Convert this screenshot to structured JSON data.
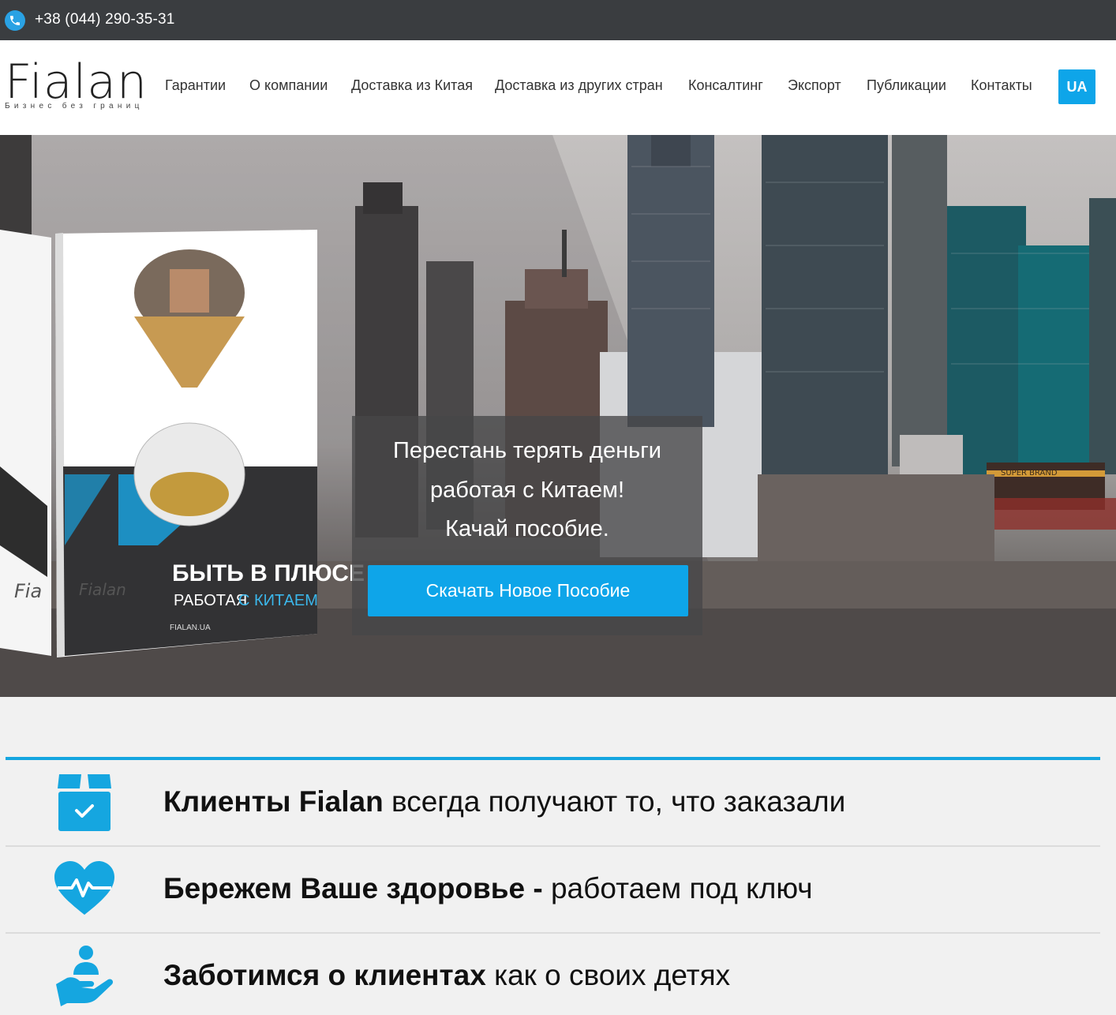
{
  "topbar": {
    "phone": "+38 (044) 290-35-31",
    "phone_icon": "phone-icon"
  },
  "header": {
    "logo_text": "Fialan",
    "logo_tagline": "Бизнес без границ",
    "nav": [
      "Гарантии",
      "О компании",
      "Доставка из Китая",
      "Доставка из других стран",
      "Консалтинг",
      "Экспорт",
      "Публикации",
      "Контакты"
    ],
    "lang": "UA"
  },
  "hero": {
    "book": {
      "title_line1": "БЫТЬ В ПЛЮСЕ",
      "title_line2a": "РАБОТАЯ",
      "title_line2b": "С КИТАЕМ",
      "brand": "Fialan",
      "brand_left": "Fia",
      "site": "FIALAN.UA",
      "spine": "FIALAN.UA"
    },
    "sign_text": "SUPER BRAND",
    "caption": [
      "Перестань терять деньги",
      "работая с Китаем!",
      "Качай пособие."
    ],
    "cta": "Скачать Новое Пособие"
  },
  "features": [
    {
      "icon": "box-check-icon",
      "bold": "Клиенты Fialan",
      "rest": " всегда получают то, что заказали"
    },
    {
      "icon": "heart-pulse-icon",
      "bold": "Бережем Ваше здоровье -",
      "rest": " работаем под ключ"
    },
    {
      "icon": "care-hand-icon",
      "bold": "Заботимся о клиентах",
      "rest": " как о своих детях"
    }
  ],
  "colors": {
    "accent": "#0ea5e9",
    "topbar": "#3a3d40"
  }
}
